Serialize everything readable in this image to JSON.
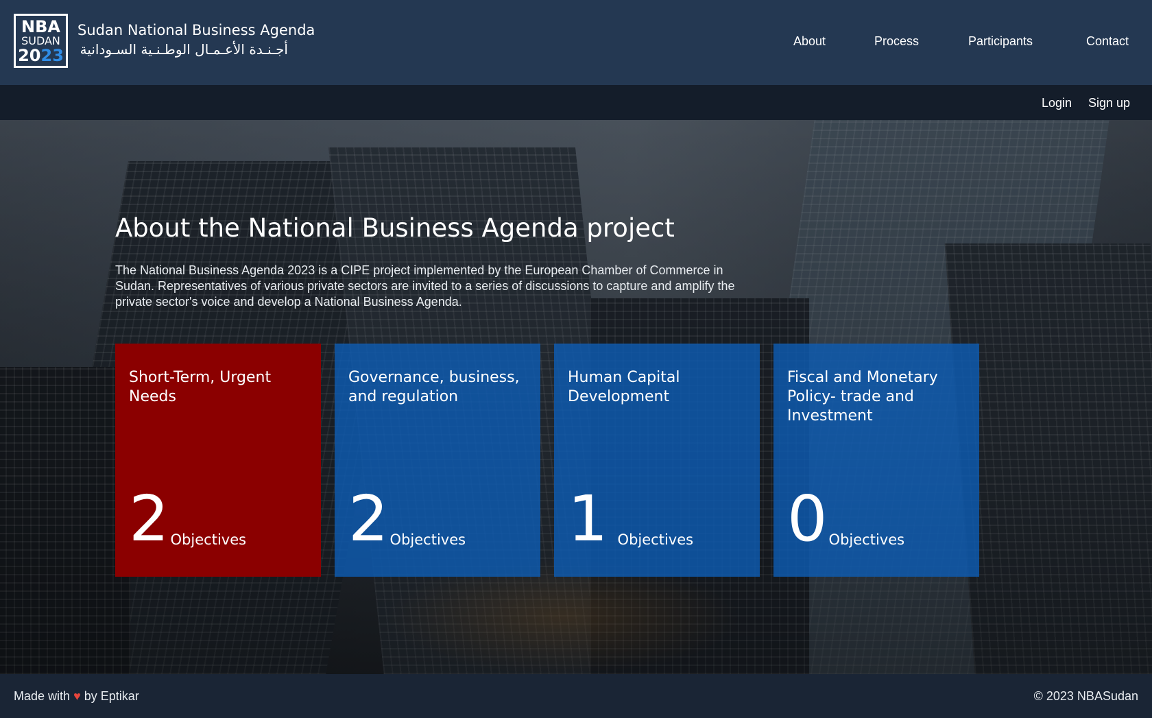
{
  "header": {
    "logo": {
      "line1": "NBA",
      "line2": "SUDAN",
      "year_a": "20",
      "year_b": "23"
    },
    "brand_en": "Sudan National Business Agenda",
    "brand_ar": "أجـنـدة الأعـمـال الوطـنـية السـودانية",
    "nav": [
      "About",
      "Process",
      "Participants",
      "Contact"
    ]
  },
  "subbar": {
    "login": "Login",
    "signup": "Sign up"
  },
  "hero": {
    "title": "About the National Business Agenda project",
    "description": "The National Business Agenda 2023 is a CIPE project implemented by the European Chamber of Commerce in Sudan. Representatives of various private sectors are invited to a series of discussions to capture and amplify the private sector's voice and develop a National Business Agenda.",
    "cards": [
      {
        "title": "Short-Term, Urgent Needs",
        "count": "2",
        "unit": "Objectives",
        "color": "#8b0000"
      },
      {
        "title": "Governance, business, and regulation",
        "count": "2",
        "unit": "Objectives",
        "color": "#0d5bb2"
      },
      {
        "title": "Human Capital Development",
        "count": "1",
        "unit": "Objectives",
        "color": "#0d5bb2"
      },
      {
        "title": "Fiscal and Monetary Policy- trade and Investment",
        "count": "0",
        "unit": "Objectives",
        "color": "#0d5bb2"
      }
    ]
  },
  "footer": {
    "made_with": "Made with",
    "heart": "♥",
    "by": "by Eptikar",
    "copyright": "© 2023 NBASudan"
  }
}
